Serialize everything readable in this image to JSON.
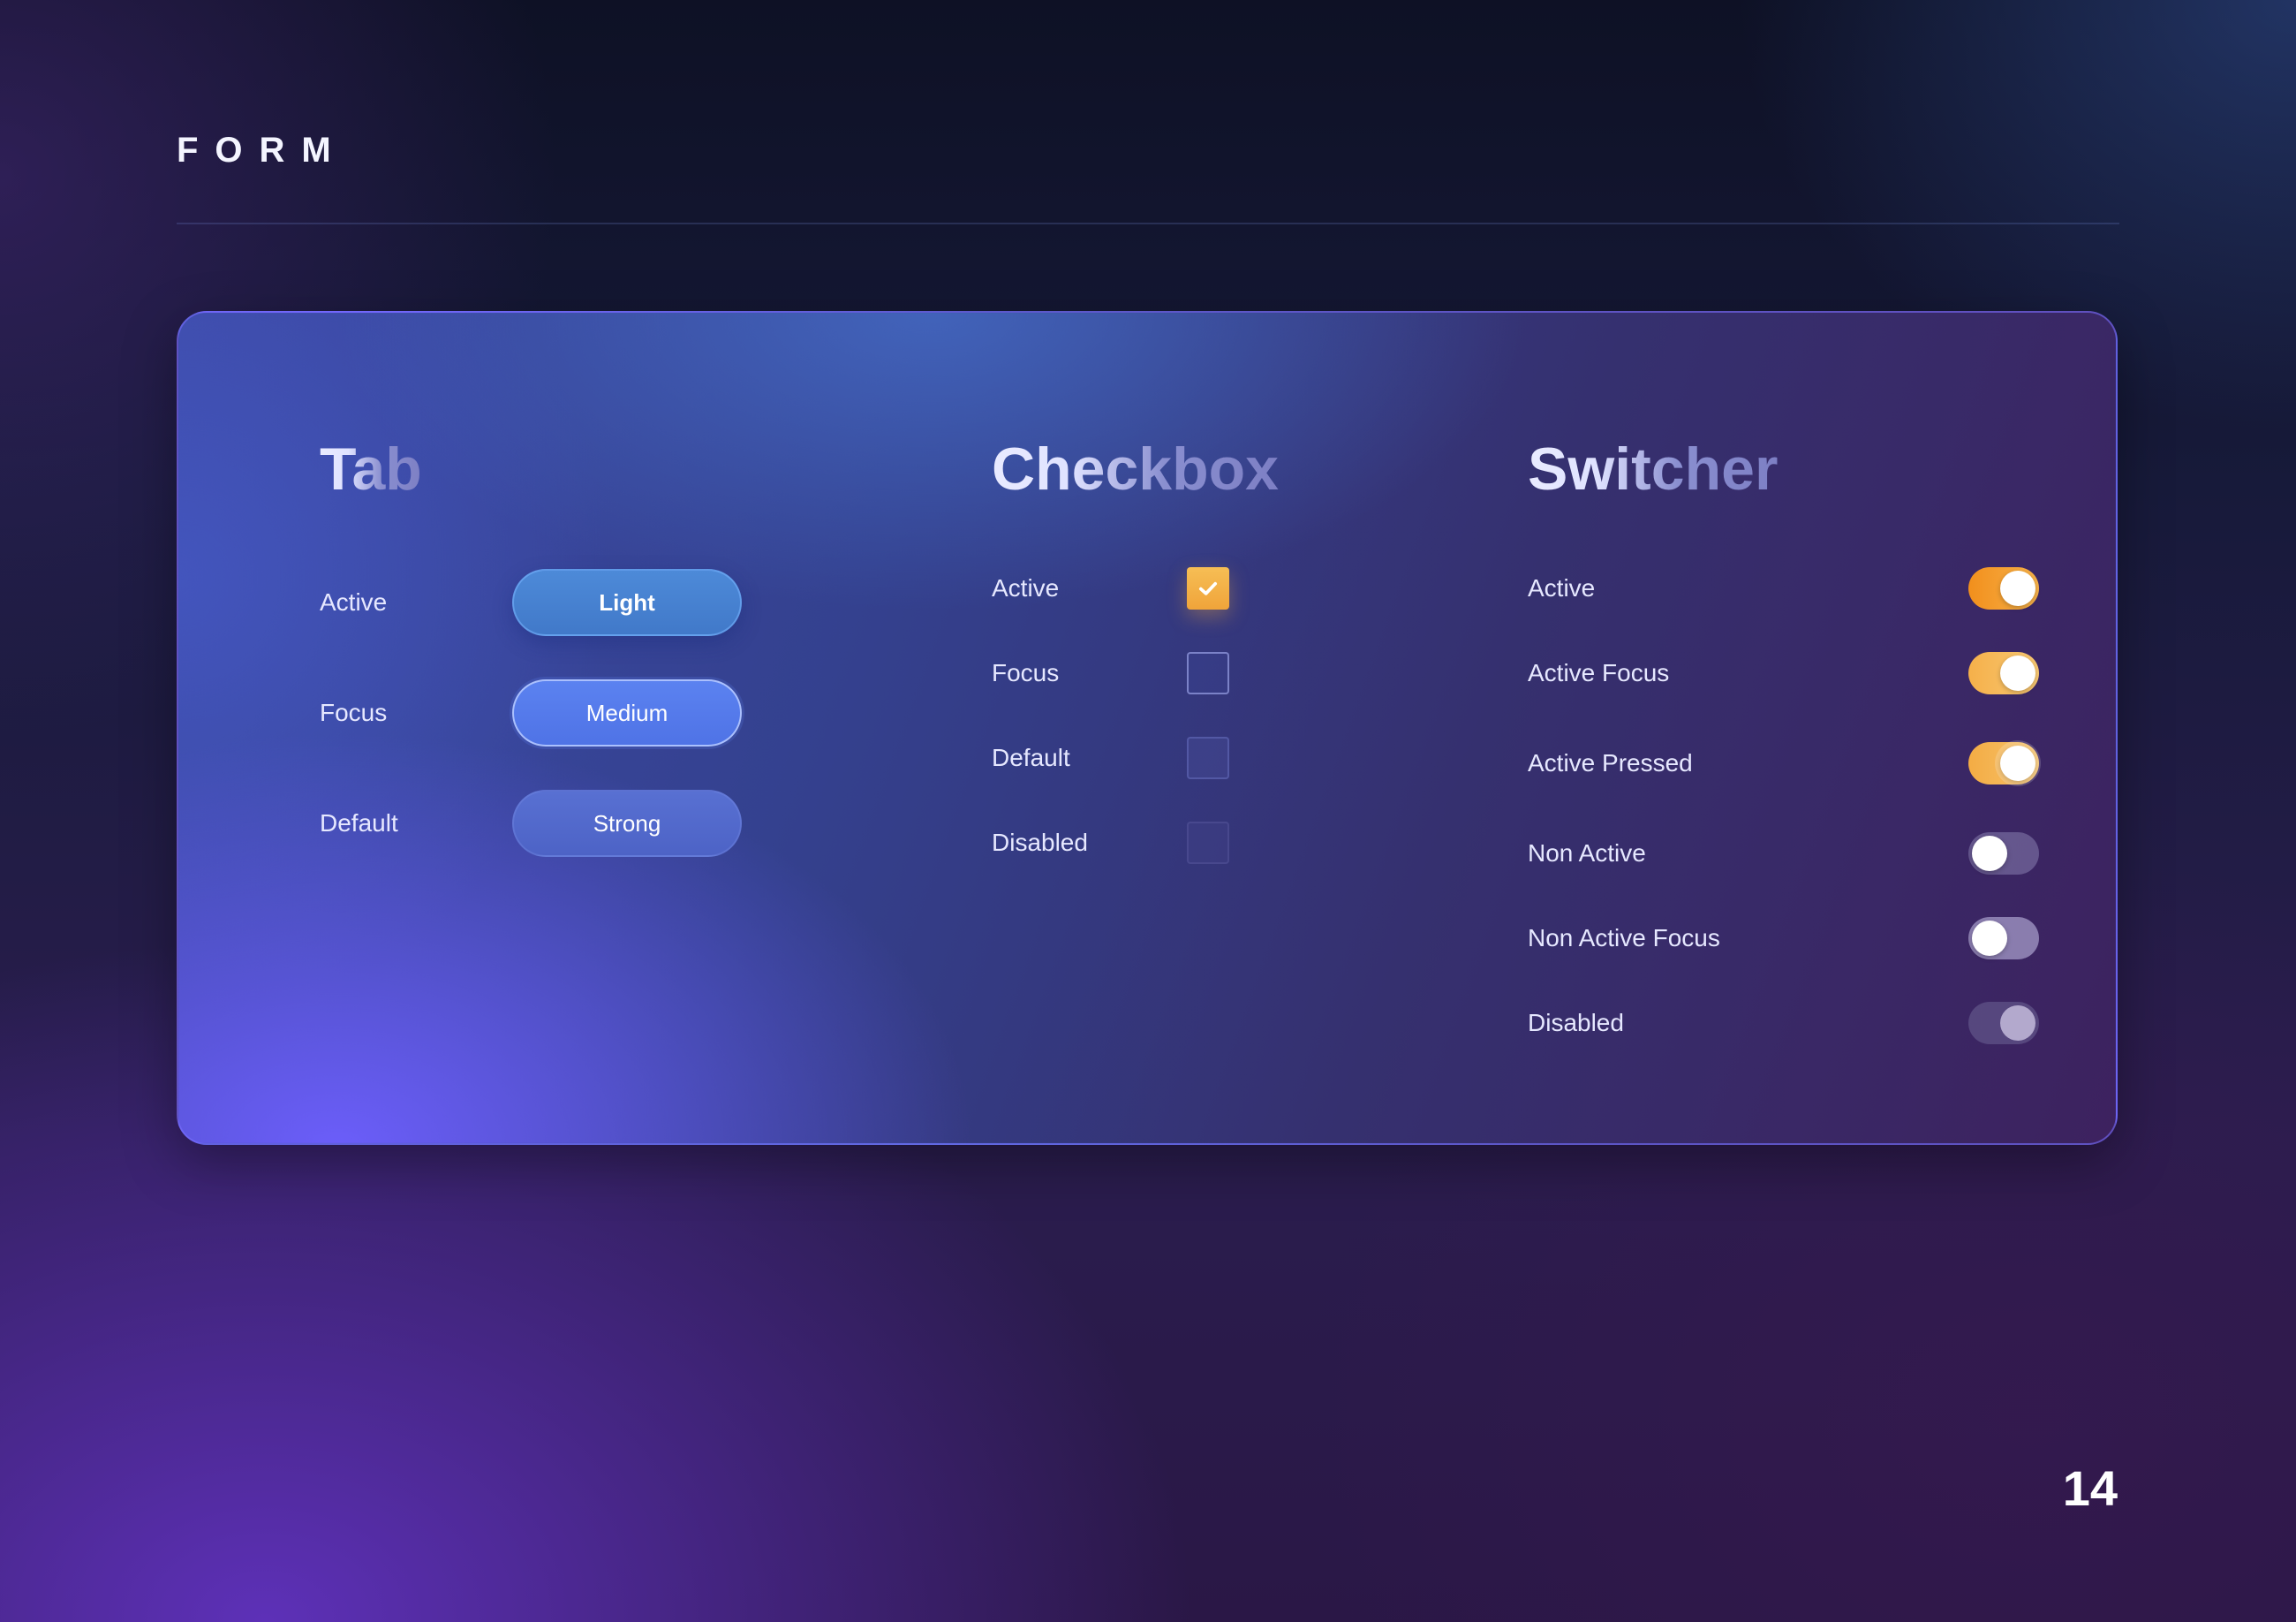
{
  "header": {
    "title": "FORM"
  },
  "card": {
    "tab": {
      "title": "Tab",
      "rows": [
        {
          "label": "Active",
          "value": "Light"
        },
        {
          "label": "Focus",
          "value": "Medium"
        },
        {
          "label": "Default",
          "value": "Strong"
        }
      ]
    },
    "checkbox": {
      "title": "Checkbox",
      "rows": [
        {
          "label": "Active",
          "checked": true
        },
        {
          "label": "Focus",
          "checked": false
        },
        {
          "label": "Default",
          "checked": false
        },
        {
          "label": "Disabled",
          "checked": false
        }
      ]
    },
    "switcher": {
      "title": "Switcher",
      "rows": [
        {
          "label": "Active",
          "on": true
        },
        {
          "label": "Active Focus",
          "on": true
        },
        {
          "label": "Active Pressed",
          "on": true
        },
        {
          "label": "Non Active",
          "on": false
        },
        {
          "label": "Non Active Focus",
          "on": false
        },
        {
          "label": "Disabled",
          "on": false
        }
      ]
    }
  },
  "footer": {
    "page_number": "14"
  },
  "colors": {
    "accent_orange": "#f6b24a",
    "tab_blue": "#4f73e6",
    "card_border": "#786eff"
  },
  "icons": {
    "checkbox_checked": "checkmark-icon"
  }
}
